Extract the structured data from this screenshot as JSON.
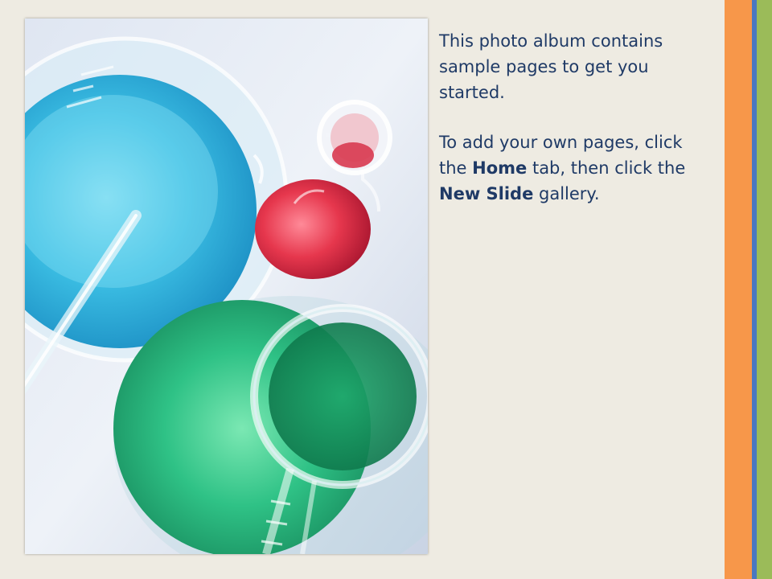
{
  "caption": {
    "paragraph1": "This photo album contains sample pages to get you started.",
    "paragraph2_part1": "To add your own pages, click the ",
    "paragraph2_home": "Home",
    "paragraph2_part2": " tab, then click the ",
    "paragraph2_new_slide": "New Slide",
    "paragraph2_part3": " gallery."
  },
  "photo": {
    "subject": "laboratory glassware with blue, red and green liquids"
  },
  "colors": {
    "background": "#eeebe2",
    "text": "#1f3a66",
    "stripe_orange": "#f7974a",
    "stripe_blue": "#4a78c0",
    "stripe_green": "#9bbb59"
  }
}
